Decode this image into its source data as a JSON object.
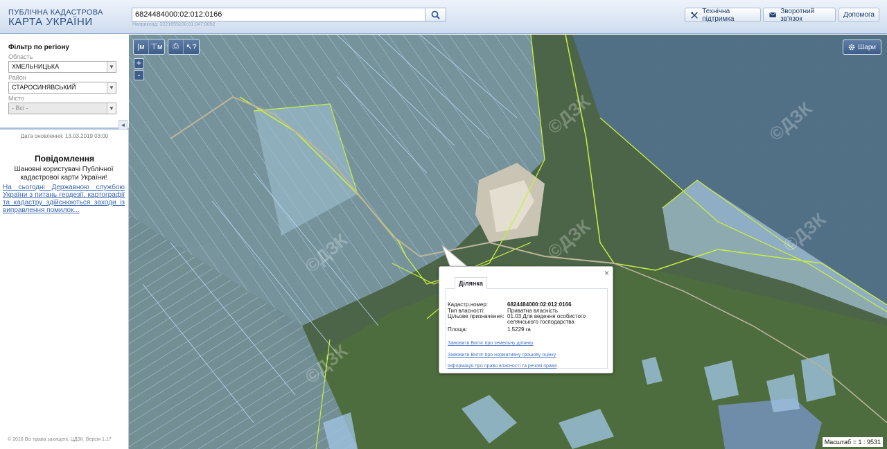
{
  "header": {
    "logo_line1": "ПУБЛІЧНА КАДАСТРОВА",
    "logo_line2": "КАРТА УКРАЇНИ",
    "search_value": "6824484000:02:012:0166",
    "search_example": "Наприклад: 3221655100:01:047:0052",
    "support_label": "Технічна підтримка",
    "feedback_label": "Зворотний зв'язок",
    "help_label": "Допомога"
  },
  "sidebar": {
    "filter_title": "Фільтр по регіону",
    "oblast_label": "Область",
    "oblast_value": "ХМЕЛЬНИЦЬКА",
    "raion_label": "Район",
    "raion_value": "СТАРОСИНЯВСЬКИЙ",
    "city_label": "Місто",
    "city_value": "- Всі -",
    "update_date": "Дата оновлення: 13.03.2019 03:00",
    "notice_title": "Повідомлення",
    "notice_body": "Шановні користувачі Публічної кадастрової карти України!",
    "notice_link": "На сьогодні Державною службою України з питань геодезії, картографії та кадастру здійснюються заходи із виправлення помилок...",
    "copyright": "© 2016 Всі права захищені, ЦДЗК. Версія 1.17"
  },
  "map": {
    "layers_label": "Шари",
    "zoom_in": "+",
    "zoom_out": "-",
    "scale": "Масштаб = 1 : 9531",
    "watermark": "©ДЗК",
    "tools": {
      "measure_line": "|м",
      "measure_area": "⊤м",
      "print": "⎙",
      "identify": "↖?"
    }
  },
  "popup": {
    "tab": "Ділянка",
    "close": "×",
    "rows": [
      {
        "k": "Кадастр.номер:",
        "v": "6824484000:02:012:0166"
      },
      {
        "k": "Тип власності:",
        "v": "Приватна власність"
      },
      {
        "k": "Цільове призначення:",
        "v": "01.03 Для ведення особистого селянського господарства"
      },
      {
        "k": "Площа:",
        "v": "1.5229 га"
      }
    ],
    "links": [
      "Замовити Витяг про земельну ділянку",
      "Замовити Витяг про нормативну грошову оцінку",
      "Інформація про право власності та речові права"
    ]
  },
  "colors": {
    "accent": "#3e5d89",
    "link": "#3a66b2",
    "parcel": "#8fc6ff",
    "boundary": "#c8f040"
  }
}
